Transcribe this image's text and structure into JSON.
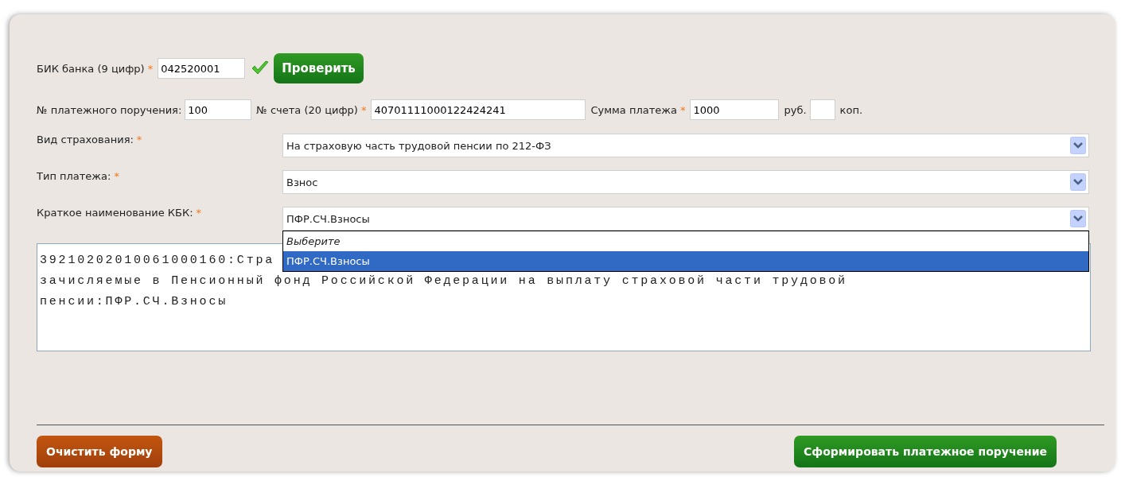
{
  "bik": {
    "label": "БИК банка (9 цифр)",
    "required_mark": "*",
    "value": "042520001",
    "verified": true,
    "check_button": "Проверить"
  },
  "payment_row": [
    {
      "label": "№ платежного поручения:",
      "value": "100"
    },
    {
      "label": "№ счета (20 цифр)",
      "required_mark": "*",
      "value": "40701111000122424241"
    },
    {
      "label": "Сумма платежа",
      "required_mark": "*",
      "value": "1000"
    },
    {
      "label": "руб.",
      "input": true
    },
    {
      "label": "коп."
    }
  ],
  "selects": [
    {
      "label": "Вид страхования:",
      "required_mark": "*",
      "value": "На страховую часть трудовой пенсии по 212-ФЗ"
    },
    {
      "label": "Тип платежа:",
      "required_mark": "*",
      "value": "Взнос"
    },
    {
      "label": "Краткое наименование КБК:",
      "required_mark": "*",
      "value": "ПФР.СЧ.Взносы",
      "options": [
        {
          "label": "Выберите",
          "kind": "placeholder",
          "selected": false
        },
        {
          "label": "ПФР.СЧ.Взносы",
          "kind": "option",
          "selected": true
        }
      ]
    }
  ],
  "description_lines": [
    "39210202010061000160:Стра",
    "зачисляемые в Пенсионный фонд Российской Федерации на выплату страховой части трудовой",
    "пенсии:ПФР.СЧ.Взносы"
  ],
  "buttons": [
    {
      "label": "Очистить форму",
      "kind": "reset"
    },
    {
      "label": "Сформировать платежное поручение",
      "kind": "submit"
    }
  ]
}
